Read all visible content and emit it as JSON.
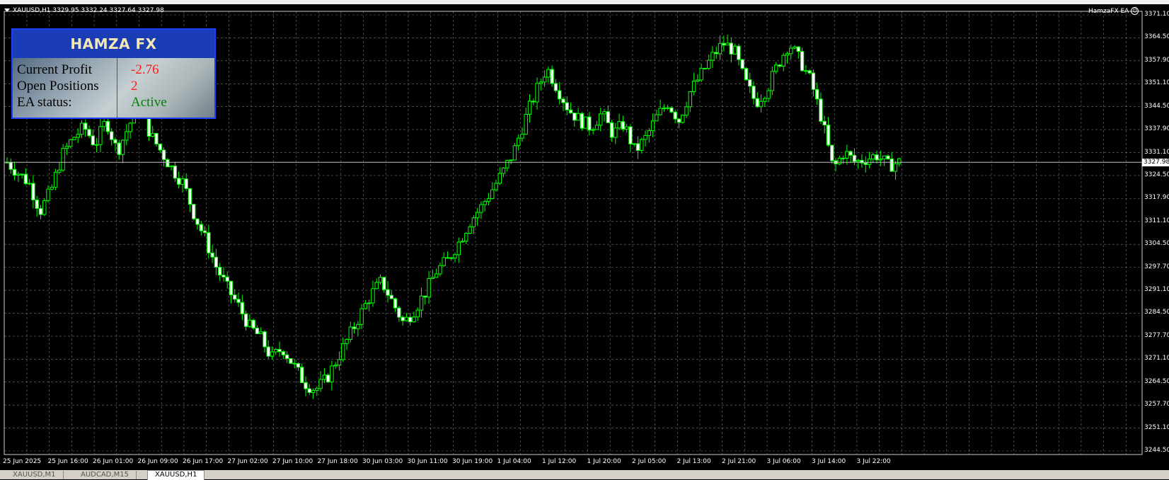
{
  "chart": {
    "symbol_info": "XAUUSD,H1  3329.95 3332.24 3327.64 3327.98",
    "ea_name": "HamzaFX EA",
    "ea_icon": "smiley-icon",
    "current_price": "3327.98",
    "price_ticks": [
      "3371.10",
      "3364.50",
      "3357.90",
      "3351.10",
      "3344.50",
      "3337.90",
      "3331.10",
      "3324.50",
      "3317.90",
      "3311.10",
      "3304.50",
      "3297.70",
      "3291.10",
      "3284.50",
      "3277.70",
      "3271.10",
      "3264.50",
      "3257.70",
      "3251.10",
      "3244.50"
    ],
    "time_ticks": [
      "25 Jun 2025",
      "25 Jun 16:00",
      "26 Jun 01:00",
      "26 Jun 09:00",
      "26 Jun 17:00",
      "27 Jun 02:00",
      "27 Jun 10:00",
      "27 Jun 18:00",
      "30 Jun 03:00",
      "30 Jun 11:00",
      "30 Jun 19:00",
      "1 Jul 04:00",
      "1 Jul 12:00",
      "1 Jul 20:00",
      "2 Jul 05:00",
      "2 Jul 13:00",
      "2 Jul 21:00",
      "3 Jul 06:00",
      "3 Jul 14:00",
      "3 Jul 22:00"
    ],
    "candle_color": "#00ff00",
    "grid_color": "#c0c0c0",
    "price_line_color": "#c0c0c0"
  },
  "panel": {
    "title": "HAMZA FX",
    "rows": [
      {
        "label": "Current Profit",
        "value": "-2.76",
        "color": "#ff1a1a"
      },
      {
        "label": "Open Positions",
        "value": "2",
        "color": "#ff1a1a"
      },
      {
        "label": "EA status:",
        "value": "Active",
        "color": "#008000"
      }
    ]
  },
  "tabs": [
    {
      "label": "XAUUSD,M1",
      "active": false
    },
    {
      "label": "AUDCAD,M15",
      "active": false
    },
    {
      "label": "XAUUSD,H1",
      "active": true
    }
  ],
  "chart_data": {
    "type": "candlestick",
    "x": [
      "25 Jun 2025",
      "25 Jun 16:00",
      "26 Jun 01:00",
      "26 Jun 09:00",
      "26 Jun 17:00",
      "27 Jun 02:00",
      "27 Jun 10:00",
      "27 Jun 18:00",
      "30 Jun 03:00",
      "30 Jun 11:00",
      "30 Jun 19:00",
      "1 Jul 04:00",
      "1 Jul 12:00",
      "1 Jul 20:00",
      "2 Jul 05:00",
      "2 Jul 13:00",
      "2 Jul 21:00",
      "3 Jul 06:00",
      "3 Jul 14:00",
      "3 Jul 22:00"
    ],
    "close_series": [
      3328,
      3325,
      3322,
      3314,
      3320,
      3330,
      3335,
      3338,
      3333,
      3340,
      3331,
      3338,
      3345,
      3336,
      3331,
      3326,
      3322,
      3313,
      3306,
      3298,
      3292,
      3287,
      3281,
      3278,
      3272,
      3275,
      3270,
      3265,
      3263,
      3266,
      3272,
      3278,
      3284,
      3290,
      3294,
      3288,
      3282,
      3286,
      3291,
      3297,
      3300,
      3305,
      3311,
      3315,
      3320,
      3325,
      3331,
      3340,
      3348,
      3355,
      3349,
      3343,
      3340,
      3338,
      3342,
      3336,
      3339,
      3331,
      3335,
      3341,
      3345,
      3340,
      3348,
      3353,
      3358,
      3362,
      3360,
      3351,
      3345,
      3349,
      3356,
      3362,
      3357,
      3351,
      3340,
      3326,
      3331,
      3328,
      3329,
      3330,
      3327,
      3328
    ],
    "ylim": [
      3244.5,
      3371.1
    ]
  }
}
